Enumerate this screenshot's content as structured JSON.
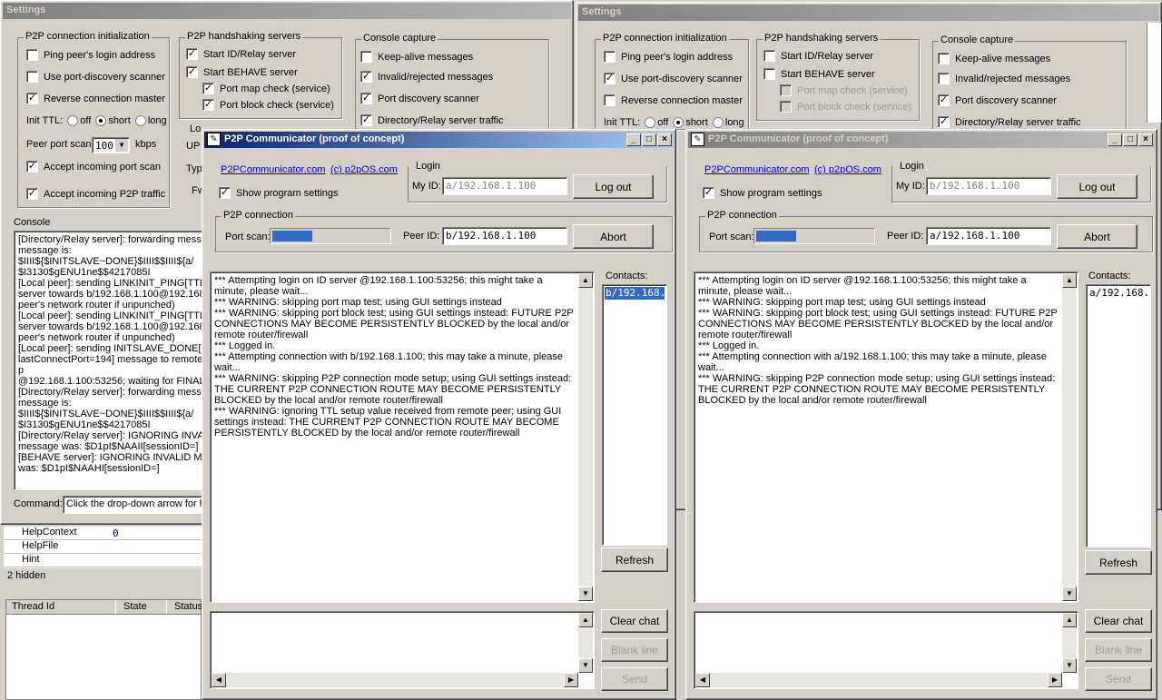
{
  "bg_settings1": {
    "title": "Settings",
    "p2p_init": {
      "label": "P2P connection initialization",
      "ping": "Ping peer's login address",
      "portdisc": "Use port-discovery scanner",
      "reverse": "Reverse connection master",
      "ttl_label": "Init TTL:",
      "ttl_off": "off",
      "ttl_short": "short",
      "ttl_long": "long",
      "peer_scan": "Peer port scan",
      "peer_scan_value": "100",
      "kbps": "kbps",
      "accept_scan": "Accept incoming port scan",
      "accept_p2p": "Accept incoming P2P traffic"
    },
    "handshake": {
      "label": "P2P handshaking servers",
      "id_relay": "Start ID/Relay server",
      "behave": "Start BEHAVE server",
      "port_map": "Port map check (service)",
      "port_block": "Port block check (service)"
    },
    "console_cap": {
      "label": "Console capture",
      "keepalive": "Keep-alive messages",
      "invalid": "Invalid/rejected messages",
      "port_scanner": "Port discovery scanner",
      "dir_relay": "Directory/Relay server traffic"
    },
    "partial": {
      "lo": "Lo",
      "up": "UP",
      "typ": "Typ",
      "fw": "Fw"
    },
    "console": {
      "label": "Console",
      "lines": [
        "[Directory/Relay server]: forwarding messa",
        "message is:",
        "$IIII${$INITSLAVE~DONE}$IIII$$IIII${a/",
        "$I3130$gENU1ne$$4217085I",
        "[Local peer]: sending LINKINIT_PING[TTL",
        "server towards b/192.168.1.100@192.168",
        "peer's network router if unpunched)",
        "[Local peer]: sending LINKINIT_PING[TTL",
        "server towards b/192.168.1.100@192.168",
        "peer's network router if unpunched)",
        "[Local peer]: sending INITSLAVE_DONE[s",
        "lastConnectPort=194] message to remote p",
        "@192.168.1.100:53256; waiting for FINAL",
        "[Directory/Relay server]: forwarding messa",
        "message is:",
        "$IIII${$INITSLAVE~DONE}$IIII$$IIII${a/",
        "$I3130$gENU1ne$$4217085I",
        "[Directory/Relay server]: IGNORING INVAL",
        "message was: $D1pI$NAAII[sessionID=]",
        "[BEHAVE server]: IGNORING INVALID MI",
        "was: $D1pI$NAAHI[sessionID=]"
      ],
      "command_label": "Command:",
      "command_value": "Click the drop-down arrow for he"
    }
  },
  "bg_props": {
    "rows": [
      {
        "name": "HelpContext",
        "value": "0"
      },
      {
        "name": "HelpFile",
        "value": ""
      },
      {
        "name": "Hint",
        "value": ""
      }
    ],
    "hidden": "2 hidden",
    "columns": [
      "Thread Id",
      "State",
      "Status"
    ]
  },
  "bg_settings2": {
    "title": "Settings",
    "p2p_init": {
      "label": "P2P connection initialization",
      "ping": "Ping peer's login address",
      "portdisc": "Use port-discovery scanner",
      "reverse": "Reverse connection master",
      "ttl_label": "Init TTL:",
      "ttl_off": "off",
      "ttl_short": "short",
      "ttl_long": "long"
    },
    "handshake": {
      "label": "P2P handshaking servers",
      "id_relay": "Start ID/Relay server",
      "behave": "Start BEHAVE server",
      "port_map": "Port map check (service)",
      "port_block": "Port block check (service)"
    },
    "console_cap": {
      "label": "Console capture",
      "keepalive": "Keep-alive messages",
      "invalid": "Invalid/rejected messages",
      "port_scanner": "Port discovery scanner",
      "dir_relay": "Directory/Relay server traffic"
    }
  },
  "comm1": {
    "title": "P2P Communicator  (proof of concept)",
    "link1": "P2PCommunicator.com",
    "link2": "(c) p2pOS.com",
    "show_settings": "Show program settings",
    "login_label": "Login",
    "myid_label": "My ID:",
    "myid_value": "a/192.168.1.100",
    "logout": "Log out",
    "p2p_label": "P2P connection",
    "portscan_label": "Port scan:",
    "portscan_progress": 0.33,
    "peerid_label": "Peer ID:",
    "peerid_value": "b/192.168.1.100",
    "abort": "Abort",
    "contacts_label": "Contacts:",
    "contacts": [
      "b/192.168.1.100"
    ],
    "refresh": "Refresh",
    "log": [
      "*** Attempting login on ID server @192.168.1.100:53256; this might take a minute, please wait...",
      "*** WARNING: skipping port map test; using GUI settings instead",
      "*** WARNING: skipping port block test; using GUI settings instead: FUTURE P2P CONNECTIONS MAY BECOME PERSISTENTLY BLOCKED by the local and/or remote router/firewall",
      "*** Logged in.",
      "*** Attempting connection with b/192.168.1.100; this may take a minute, please wait...",
      "*** WARNING: skipping P2P connection mode setup; using GUI settings instead: THE CURRENT P2P CONNECTION ROUTE MAY BECOME PERSISTENTLY BLOCKED by the local and/or remote router/firewall",
      "*** WARNING: ignoring TTL setup value received from remote peer; using GUI settings instead: THE CURRENT P2P CONNECTION ROUTE MAY BECOME PERSISTENTLY BLOCKED by the local and/or remote router/firewall"
    ],
    "clear_chat": "Clear chat",
    "blank_line": "Blank line",
    "send": "Send"
  },
  "comm2": {
    "title": "P2P Communicator  (proof of concept)",
    "link1": "P2PCommunicator.com",
    "link2": "(c) p2pOS.com",
    "show_settings": "Show program settings",
    "login_label": "Login",
    "myid_label": "My ID:",
    "myid_value": "b/192.168.1.100",
    "logout": "Log out",
    "p2p_label": "P2P connection",
    "portscan_label": "Port scan:",
    "portscan_progress": 0.33,
    "peerid_label": "Peer ID:",
    "peerid_value": "a/192.168.1.100",
    "abort": "Abort",
    "contacts_label": "Contacts:",
    "contacts": [
      "a/192.168.1.100"
    ],
    "refresh": "Refresh",
    "log": [
      "*** Attempting login on ID server @192.168.1.100:53256; this might take a minute, please wait...",
      "*** WARNING: skipping port map test; using GUI settings instead",
      "*** WARNING: skipping port block test; using GUI settings instead: FUTURE P2P CONNECTIONS MAY BECOME PERSISTENTLY BLOCKED by the local and/or remote router/firewall",
      "*** Logged in.",
      "*** Attempting connection with a/192.168.1.100; this may take a minute, please wait...",
      "*** WARNING: skipping P2P connection mode setup; using GUI settings instead: THE CURRENT P2P CONNECTION ROUTE MAY BECOME PERSISTENTLY BLOCKED by the local and/or remote router/firewall"
    ],
    "clear_chat": "Clear chat",
    "blank_line": "Blank line",
    "send": "Send"
  },
  "colors": {
    "face": "#d4d0c8",
    "title_active": "#0a246a",
    "selection": "#316ac5",
    "link": "#0000ee"
  }
}
